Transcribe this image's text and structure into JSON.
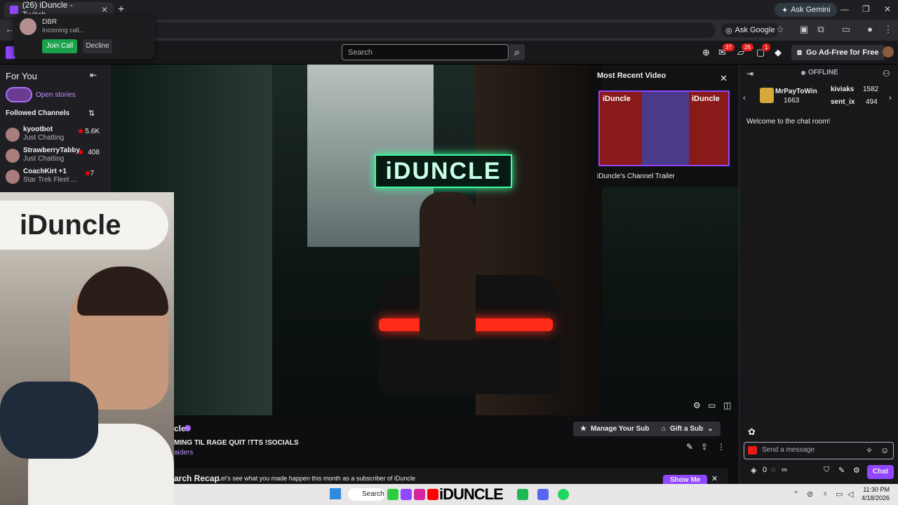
{
  "browser": {
    "tab_title": "(26) iDuncle - Twitch",
    "ask_gemini": "Ask Gemini",
    "ask_google": "Ask Google"
  },
  "call": {
    "caller": "DBR",
    "status": "Incoming call...",
    "join": "Join Call",
    "decline": "Decline"
  },
  "topnav": {
    "search_placeholder": "Search",
    "badges": [
      "37",
      "26",
      "1"
    ],
    "adfree": "Go Ad-Free for Free"
  },
  "sidebar": {
    "for_you": "For You",
    "open_stories": "Open stories",
    "followed": "Followed Channels",
    "channels": [
      {
        "name": "kyootbot",
        "game": "Just Chatting",
        "viewers": "5.6K"
      },
      {
        "name": "StrawberryTabby",
        "game": "Just Chatting",
        "viewers": "408"
      },
      {
        "name": "CoachKirt +1",
        "game": "Star Trek Fleet ...",
        "viewers": "7"
      }
    ]
  },
  "video": {
    "sign_text": "iDUNCLE",
    "most_recent_title": "Most Recent Video",
    "trailer_caption": "iDuncle's Channel Trailer",
    "thumb_left": "iDuncle",
    "thumb_right": "iDuncle"
  },
  "webcam": {
    "sign": "iDuncle"
  },
  "info": {
    "channel_name": "cle",
    "stream_title": "MING TIL RAGE QUIT !TTS !SOCIALS",
    "category": "aiders",
    "manage_sub": "Manage Your Sub",
    "gift_sub": "Gift a Sub",
    "recap_title": "arch Recap",
    "recap_text": "Let's see what you made happen this month as a subscriber of iDuncle",
    "show_me": "Show Me"
  },
  "chat": {
    "status": "OFFLINE",
    "leaderboard": [
      {
        "name": "MrPayToWin",
        "score": "1663"
      },
      {
        "name": "kiviaks",
        "score": "1582"
      },
      {
        "name": "sent_ix",
        "score": "494"
      }
    ],
    "welcome": "Welcome to the chat room!",
    "placeholder": "Send a message",
    "points": "0",
    "chat_button": "Chat"
  },
  "taskbar": {
    "search": "Search",
    "brand": "iDUNCLE",
    "time": "11:30 PM",
    "date": "4/18/2026"
  },
  "colors": {
    "twitch_purple": "#9146ff",
    "live_red": "#eb0400",
    "neon_green": "#3aff9e"
  }
}
